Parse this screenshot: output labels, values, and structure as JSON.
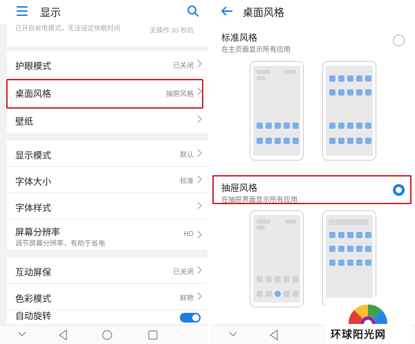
{
  "left": {
    "title": "显示",
    "cut_row": {
      "text": "已开启省电模式，无法设定休眠时间",
      "value": "无操作 30 秒后"
    },
    "group1": [
      {
        "label": "护眼模式",
        "value": "已关闭"
      },
      {
        "label": "桌面风格",
        "value": "抽屉风格"
      },
      {
        "label": "壁纸",
        "value": ""
      }
    ],
    "group2": [
      {
        "label": "显示模式",
        "value": "默认"
      },
      {
        "label": "字体大小",
        "value": "标准"
      },
      {
        "label": "字体样式",
        "value": ""
      },
      {
        "label": "屏幕分辨率",
        "value": "HD",
        "sub": "调节屏幕分辨率，有助于省电"
      }
    ],
    "group3": [
      {
        "label": "互动屏保",
        "value": "已关闭"
      },
      {
        "label": "色彩模式",
        "value": "鲜艳"
      },
      {
        "label": "自动旋转",
        "toggle": true
      }
    ]
  },
  "right": {
    "title": "桌面风格",
    "options": [
      {
        "title": "标准风格",
        "desc": "在主页面显示所有应用",
        "selected": false
      },
      {
        "title": "抽屉风格",
        "desc": "在抽屉界面显示所有应用",
        "selected": true
      }
    ]
  },
  "watermark": "环球阳光网",
  "colors": {
    "accent": "#1e7fe0",
    "highlight": "#c8222c",
    "icon_blue": "#7eaeea"
  },
  "icons": [
    "menu-icon",
    "search-icon",
    "chevron-right-icon",
    "back-arrow-icon",
    "nav-back-icon",
    "nav-home-icon",
    "nav-recent-icon",
    "nav-collapse-icon"
  ]
}
